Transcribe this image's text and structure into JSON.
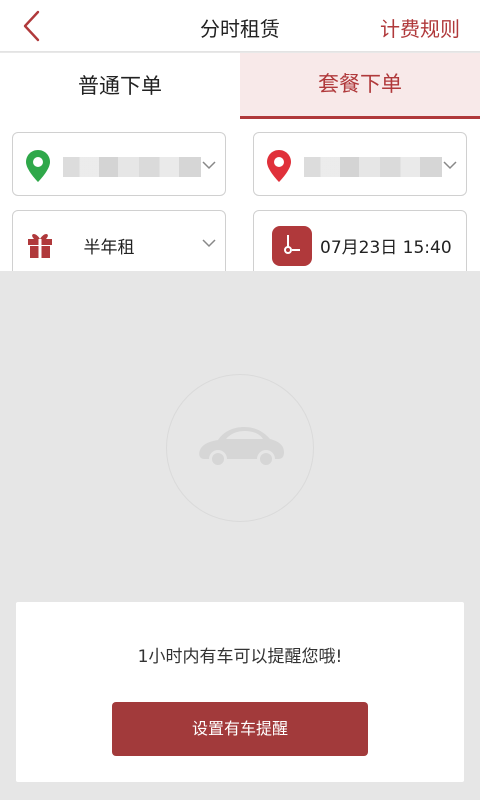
{
  "header": {
    "title": "分时租赁",
    "action_label": "计费规则"
  },
  "tabs": [
    {
      "label": "普通下单",
      "active": false
    },
    {
      "label": "套餐下单",
      "active": true
    }
  ],
  "form": {
    "pickup_location": {
      "icon": "location-pin-green-icon"
    },
    "return_location": {
      "icon": "location-pin-red-icon"
    },
    "package": {
      "label": "半年租",
      "icon": "gift-icon"
    },
    "start_time": {
      "label": "07月23日 15:40",
      "icon": "clock-icon"
    }
  },
  "empty_state": {
    "icon": "car-icon"
  },
  "reminder_card": {
    "message": "1小时内有车可以提醒您哦!",
    "button_label": "设置有车提醒"
  },
  "colors": {
    "accent": "#b0393b",
    "button": "#a23a3b",
    "pin_green": "#2fa84a",
    "pin_red": "#e0303a"
  }
}
